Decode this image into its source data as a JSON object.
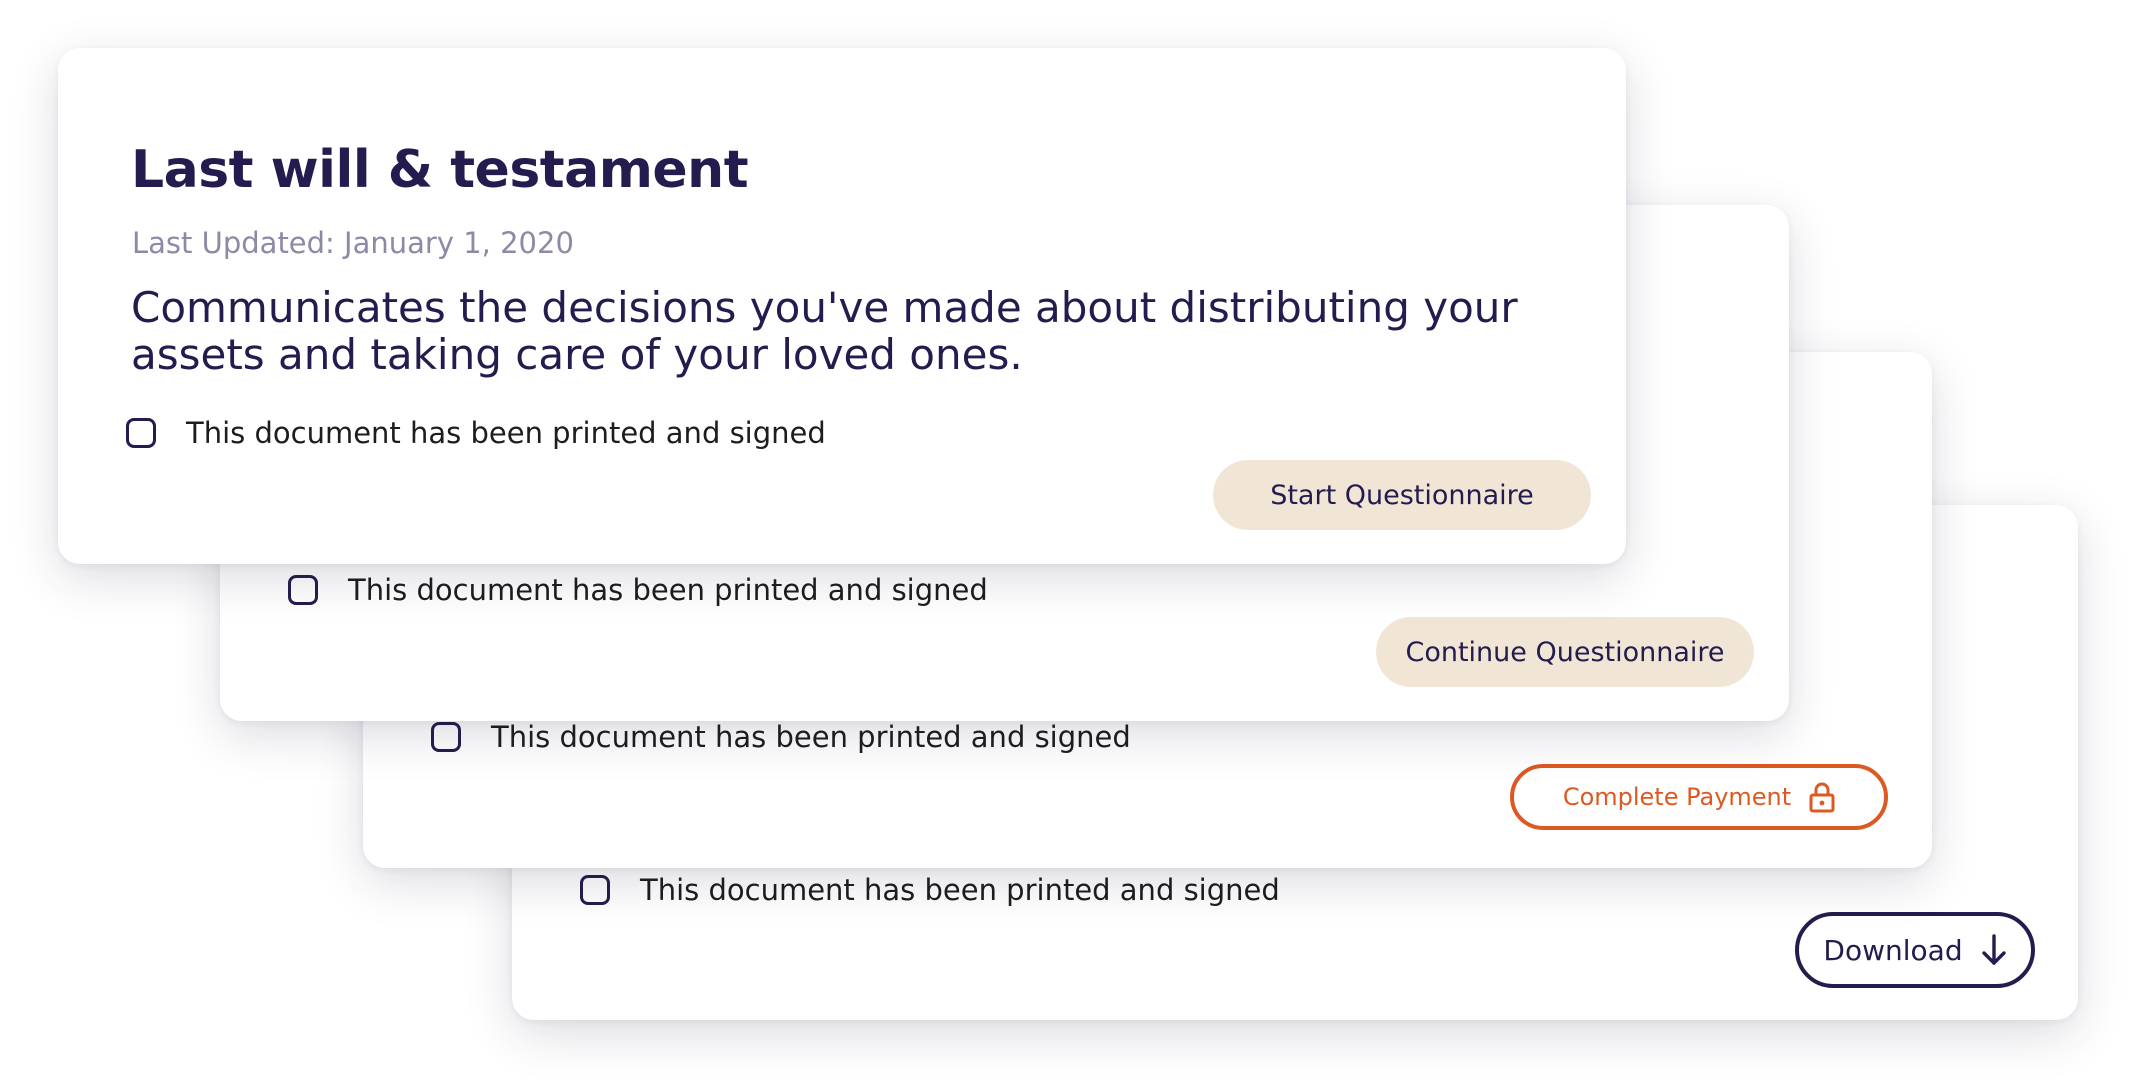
{
  "cards": [
    {
      "title": "Last will & testament",
      "last_updated": "Last Updated: January 1, 2020",
      "description": "Communicates the decisions you've made about distributing your assets and taking care of your loved ones.",
      "checkbox_label": "This document has been printed and signed",
      "checked": false,
      "button_label": "Start Questionnaire"
    },
    {
      "checkbox_label": "This document has been printed and signed",
      "checked": false,
      "button_label": "Continue Questionnaire"
    },
    {
      "checkbox_label": "This document has been printed and signed",
      "checked": false,
      "button_label": "Complete Payment",
      "button_icon": "lock-icon"
    },
    {
      "checkbox_label": "This document has been printed and signed",
      "checked": false,
      "button_label": "Download",
      "button_icon": "arrow-down-icon"
    }
  ],
  "colors": {
    "primary": "#241c4e",
    "muted": "#8d8aa6",
    "button_fill": "#f1e6d6",
    "payment_accent": "#dc5a22"
  }
}
